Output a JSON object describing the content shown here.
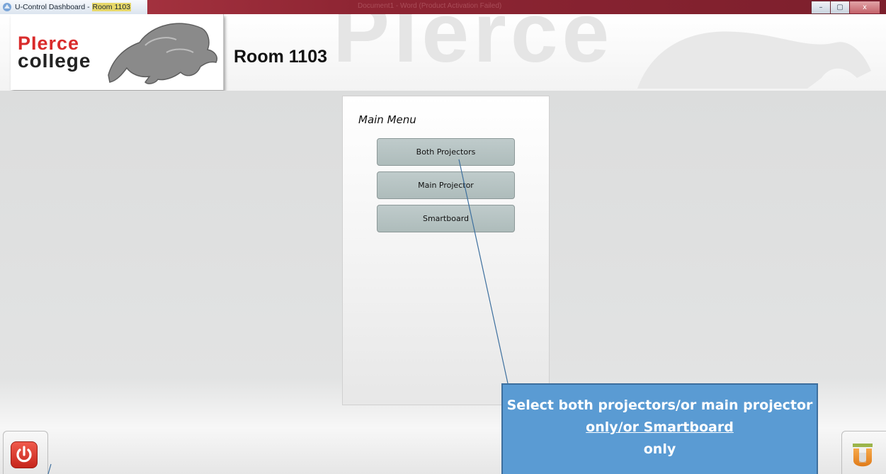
{
  "window": {
    "title_app": "U-Control Dashboard - ",
    "title_room": "Room 1103",
    "background_title": "Document1 - Word (Product Activation Failed)",
    "controls": {
      "minimize": "–",
      "maximize": "▢",
      "close": "x"
    }
  },
  "header": {
    "logo_line1": "PIerce",
    "logo_line2": "coIIege",
    "room_title": "Room 1103",
    "watermark": "PIerce"
  },
  "menu": {
    "title": "Main Menu",
    "buttons": [
      {
        "label": "Both Projectors"
      },
      {
        "label": "Main Projector"
      },
      {
        "label": "Smartboard"
      }
    ]
  },
  "callout": {
    "part1": "Select both projectors/or main projector",
    "part2_underlined": " only/or Smartboard",
    "part3": "only"
  },
  "icons": {
    "app": "u-control-app-icon",
    "power": "power-icon",
    "u_logo": "u-logo-icon"
  },
  "colors": {
    "titlebar": "#8e2533",
    "menu_button": "#b7c4c3",
    "callout": "#5a9bd3",
    "power": "#d93a2f"
  }
}
